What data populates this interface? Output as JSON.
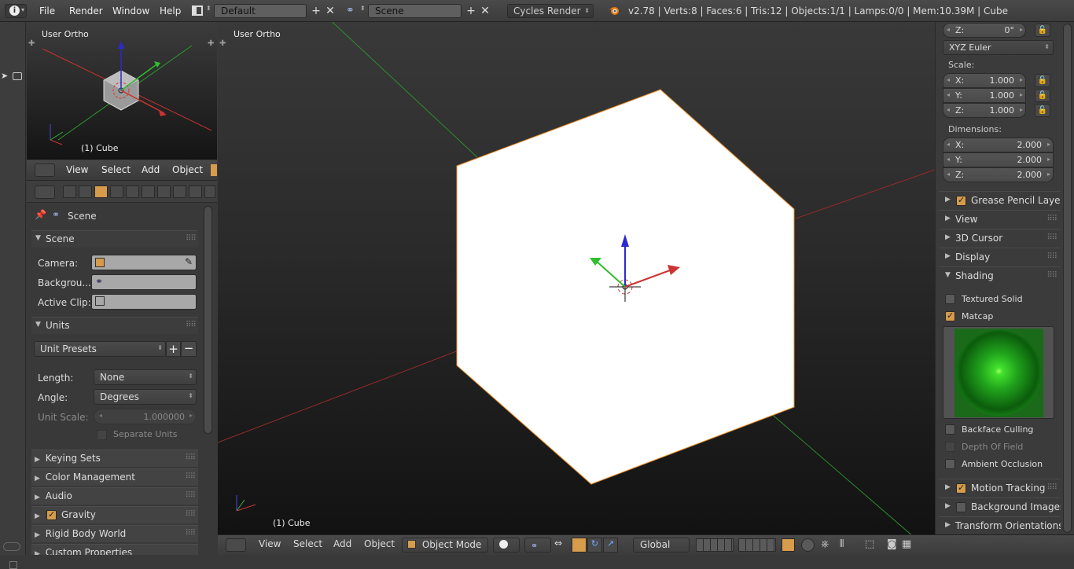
{
  "topbar": {
    "info_icon": "info-icon",
    "menus": [
      "File",
      "Render",
      "Window",
      "Help"
    ],
    "screen_layout": "Default",
    "scene": "Scene",
    "render_engine": "Cycles Render",
    "status": "v2.78 | Verts:8 | Faces:6 | Tris:12 | Objects:1/1 | Lamps:0/0 | Mem:10.39M | Cube"
  },
  "miniview": {
    "title": "User Ortho",
    "object": "(1) Cube"
  },
  "mini_header": {
    "menus": [
      "View",
      "Select",
      "Add",
      "Object"
    ]
  },
  "properties": {
    "context": "Scene",
    "scene_panel": {
      "title": "Scene",
      "camera_label": "Camera:",
      "background_label": "Backgrou...",
      "active_clip_label": "Active Clip:"
    },
    "units_panel": {
      "title": "Units",
      "unit_presets": "Unit Presets",
      "length_label": "Length:",
      "length_value": "None",
      "angle_label": "Angle:",
      "angle_value": "Degrees",
      "unit_scale_label": "Unit Scale:",
      "unit_scale_value": "1.000000",
      "separate_units": "Separate Units"
    },
    "collapsed_panels": [
      "Keying Sets",
      "Color Management",
      "Audio",
      "Gravity",
      "Rigid Body World",
      "Custom Properties"
    ]
  },
  "mainview": {
    "title": "User Ortho",
    "object": "(1) Cube"
  },
  "bottombar": {
    "menus": [
      "View",
      "Select",
      "Add",
      "Object"
    ],
    "mode": "Object Mode",
    "orientation": "Global"
  },
  "npanel": {
    "rot_z_label": "Z:",
    "rot_z_value": "0°",
    "rotation_mode": "XYZ Euler",
    "scale_label": "Scale:",
    "scale": [
      {
        "axis": "X:",
        "value": "1.000"
      },
      {
        "axis": "Y:",
        "value": "1.000"
      },
      {
        "axis": "Z:",
        "value": "1.000"
      }
    ],
    "dimensions_label": "Dimensions:",
    "dimensions": [
      {
        "axis": "X:",
        "value": "2.000"
      },
      {
        "axis": "Y:",
        "value": "2.000"
      },
      {
        "axis": "Z:",
        "value": "2.000"
      }
    ],
    "sections": {
      "grease_pencil": "Grease Pencil Layers",
      "view": "View",
      "cursor": "3D Cursor",
      "display": "Display",
      "shading": "Shading"
    },
    "shading": {
      "textured_solid": "Textured Solid",
      "matcap": "Matcap",
      "backface_culling": "Backface Culling",
      "depth_of_field": "Depth Of Field",
      "ambient_occlusion": "Ambient Occlusion"
    },
    "bottom_sections": {
      "motion_tracking": "Motion Tracking",
      "background_images": "Background Images",
      "transform_orientations": "Transform Orientations"
    }
  },
  "colors": {
    "accent": "#d69b4b",
    "x_axis": "#c83232",
    "y_axis": "#32b432",
    "z_axis": "#3232dc",
    "matcap_green": "#22cc22"
  }
}
